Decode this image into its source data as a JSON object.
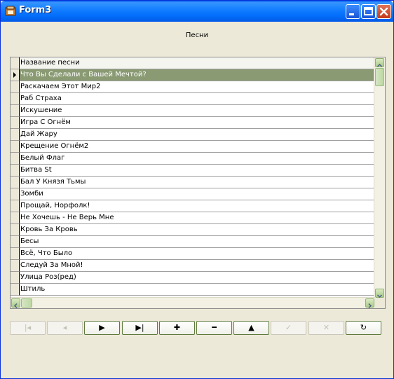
{
  "window": {
    "title": "Form3",
    "icons": {
      "app": "app-icon",
      "minimize": "minimize-icon",
      "maximize": "maximize-icon",
      "close": "close-icon"
    }
  },
  "header_label": "Песни",
  "grid": {
    "column_header": "Название песни",
    "selected_index": 0,
    "rows": [
      "Что Вы Сделали с Вашей Мечтой?",
      "Раскачаем Этот Мир2",
      " Раб Страха",
      "Искушение",
      "Игра С Огнём",
      "Дай Жару",
      "Крещение Огнём2",
      "Белый Флаг",
      "Битва St",
      "Бал У Князя Тьмы",
      "Зомби",
      "Прощай, Норфолк!",
      "Не Хочешь - Не Верь Мне",
      "Кровь За Кровь",
      "Бесы",
      "Всё, Что Было",
      "Следуй За Мной!",
      "Улица Роз(ред)",
      "Штиль"
    ]
  },
  "navigator": [
    {
      "name": "first-button",
      "icon": "first-record-icon",
      "glyph": "|◂",
      "enabled": false
    },
    {
      "name": "prior-button",
      "icon": "prior-record-icon",
      "glyph": "◂",
      "enabled": false
    },
    {
      "name": "next-button",
      "icon": "next-record-icon",
      "glyph": "▶",
      "enabled": true
    },
    {
      "name": "last-button",
      "icon": "last-record-icon",
      "glyph": "▶|",
      "enabled": true
    },
    {
      "name": "insert-button",
      "icon": "plus-icon",
      "glyph": "✚",
      "enabled": true
    },
    {
      "name": "delete-button",
      "icon": "minus-icon",
      "glyph": "━",
      "enabled": true
    },
    {
      "name": "edit-button",
      "icon": "up-triangle-icon",
      "glyph": "▲",
      "enabled": true
    },
    {
      "name": "post-button",
      "icon": "checkmark-icon",
      "glyph": "✓",
      "enabled": false
    },
    {
      "name": "cancel-button",
      "icon": "x-icon",
      "glyph": "✕",
      "enabled": false
    },
    {
      "name": "refresh-button",
      "icon": "refresh-icon",
      "glyph": "↻",
      "enabled": true
    }
  ],
  "colors": {
    "selection": "#8a9a73",
    "window_face": "#ece9d8",
    "title_blue": "#0058ee"
  }
}
